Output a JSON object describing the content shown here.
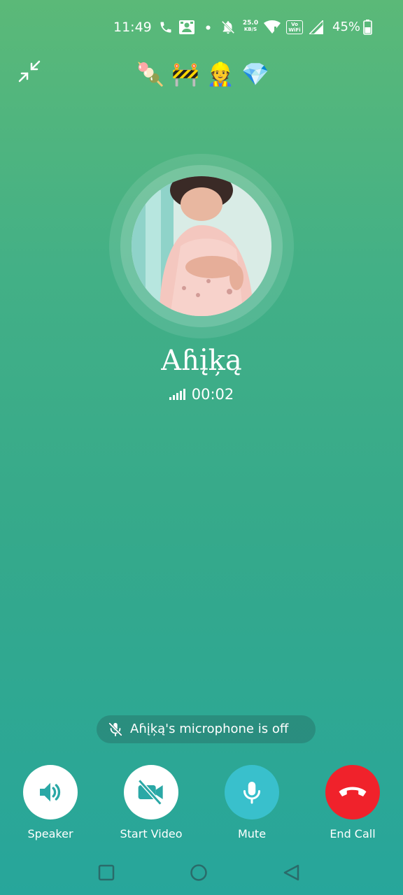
{
  "status_bar": {
    "time": "11:49",
    "net_speed_value": "25.0",
    "net_speed_unit": "KB/S",
    "vowifi_line1": "Vo",
    "vowifi_line2": "WiFi",
    "battery_percent": "45%",
    "icons": [
      "phone-icon",
      "contacts-notification-icon",
      "dot-icon",
      "mute-bell-icon",
      "wifi-icon",
      "vowifi-icon",
      "signal-icon",
      "battery-icon"
    ]
  },
  "header": {
    "emojis": [
      "🍡",
      "🚧",
      "👷",
      "💎"
    ]
  },
  "caller": {
    "name": "Aɦį̇ķą",
    "timer": "00:02"
  },
  "toast": {
    "text": "Aɦį̇ķą's microphone is off"
  },
  "controls": [
    {
      "label": "Speaker",
      "icon": "speaker-icon"
    },
    {
      "label": "Start Video",
      "icon": "video-off-icon"
    },
    {
      "label": "Mute",
      "icon": "microphone-icon"
    },
    {
      "label": "End Call",
      "icon": "end-call-icon"
    }
  ],
  "colors": {
    "accent_teal": "#39c0cc",
    "end_call_red": "#f0222b",
    "icon_teal": "#2aa8a6"
  }
}
